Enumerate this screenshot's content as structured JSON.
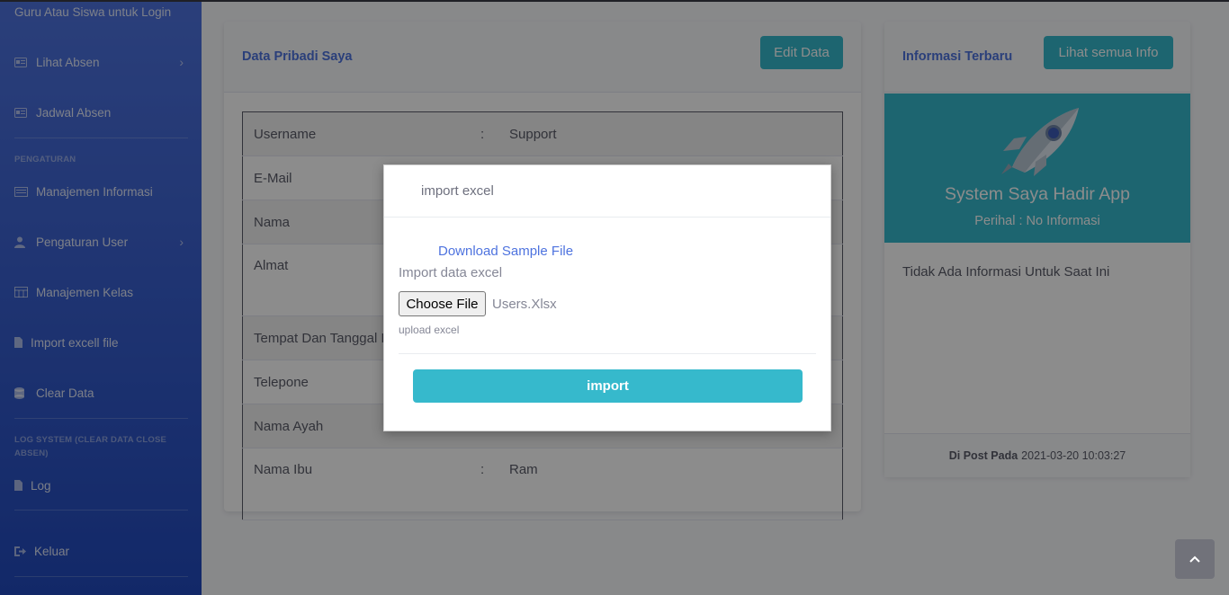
{
  "sidebar": {
    "top_text": "Guru Atau Siswa untuk Login",
    "items": [
      {
        "label": "Lihat Absen",
        "icon": "id-card-icon",
        "chevron": "›"
      },
      {
        "label": "Jadwal Absen",
        "icon": "id-card-icon"
      },
      {
        "label": "Manajemen Informasi",
        "icon": "newspaper-icon"
      },
      {
        "label": "Pengaturan User",
        "icon": "user-icon",
        "chevron": "›"
      },
      {
        "label": "Manajemen Kelas",
        "icon": "table-icon"
      },
      {
        "label": "Import excell file",
        "icon": "file-icon"
      },
      {
        "label": "Clear Data",
        "icon": "database-icon"
      },
      {
        "label": "Log",
        "icon": "document-icon"
      },
      {
        "label": "Keluar",
        "icon": "sign-out-icon"
      }
    ],
    "headings": {
      "pengaturan": "PENGATURAN",
      "log_system": "LOG SYSTEM (CLEAR DATA CLOSE ABSEN)"
    }
  },
  "profile_card": {
    "title": "Data Pribadi Saya",
    "edit_button": "Edit Data",
    "separator": ":",
    "rows": [
      {
        "label": "Username",
        "value": "Support"
      },
      {
        "label": "E-Mail",
        "value": ""
      },
      {
        "label": "Nama",
        "value": ""
      },
      {
        "label": "Almat",
        "value": ""
      },
      {
        "label": "Tempat Dan Tanggal Lahir",
        "value": ""
      },
      {
        "label": "Telepone",
        "value": ""
      },
      {
        "label": "Nama Ayah",
        "value": ""
      },
      {
        "label": "Nama Ibu",
        "value": "Ram"
      }
    ]
  },
  "info_card": {
    "title": "Informasi Terbaru",
    "button": "Lihat semua Info",
    "banner_title": "System Saya Hadir App",
    "banner_subtitle": "Perihal : No Informasi",
    "body_text": "Tidak Ada Informasi Untuk Saat Ini",
    "footer_label": "Di Post Pada",
    "footer_date": "2021-03-20 10:03:27"
  },
  "modal": {
    "title": "import excel",
    "download_link": "Download Sample File",
    "import_label": "Import data excel",
    "choose_file": "Choose File",
    "file_name": "Users.Xlsx",
    "upload_hint": "upload excel",
    "import_button": "import"
  },
  "colors": {
    "primary": "#4e73df",
    "info": "#36b9cc"
  }
}
